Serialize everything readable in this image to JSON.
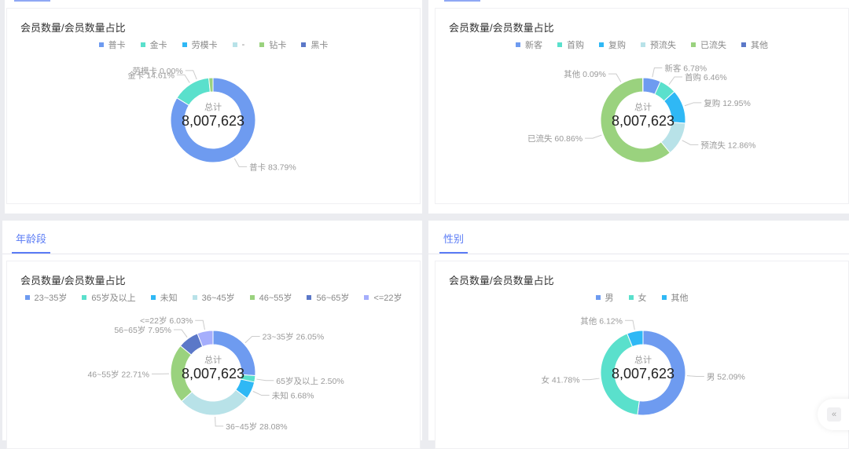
{
  "tabs": {
    "age": "年龄段",
    "gender": "性别"
  },
  "collapse_label": "«",
  "chart_data": [
    {
      "type": "pie",
      "title": "会员数量/会员数量占比",
      "center_label": "总计",
      "total": "8,007,623",
      "categories": [
        "普卡",
        "金卡",
        "劳模卡",
        "-",
        "钻卡",
        "黑卡"
      ],
      "values": [
        83.79,
        14.61,
        0.0,
        0,
        1.6,
        0
      ],
      "labels": [
        "普卡 83.79%",
        "金卡 14.61%",
        "劳模卡 0.00%",
        "",
        "",
        ""
      ],
      "colors": [
        "#6e9bf0",
        "#5ae0cc",
        "#2fb8f5",
        "#b8e2e8",
        "#9ad27e",
        "#5b78c8"
      ]
    },
    {
      "type": "pie",
      "title": "会员数量/会员数量占比",
      "center_label": "总计",
      "total": "8,007,623",
      "categories": [
        "新客",
        "首购",
        "复购",
        "预流失",
        "已流失",
        "其他"
      ],
      "values": [
        6.78,
        6.46,
        12.95,
        12.86,
        60.86,
        0.09
      ],
      "labels": [
        "新客 6.78%",
        "首购 6.46%",
        "复购 12.95%",
        "预流失 12.86%",
        "已流失 60.86%",
        "其他 0.09%"
      ],
      "colors": [
        "#6e9bf0",
        "#5ae0cc",
        "#2fb8f5",
        "#b8e2e8",
        "#9ad27e",
        "#5b78c8"
      ]
    },
    {
      "type": "pie",
      "title": "会员数量/会员数量占比",
      "center_label": "总计",
      "total": "8,007,623",
      "categories": [
        "23~35岁",
        "65岁及以上",
        "未知",
        "36~45岁",
        "46~55岁",
        "56~65岁",
        "<=22岁"
      ],
      "values": [
        26.05,
        2.5,
        6.68,
        28.08,
        22.71,
        7.95,
        6.03
      ],
      "labels": [
        "23~35岁 26.05%",
        "65岁及以上 2.50%",
        "未知 6.68%",
        "36~45岁 28.08%",
        "46~55岁 22.71%",
        "56~65岁 7.95%",
        "<=22岁 6.03%"
      ],
      "colors": [
        "#6e9bf0",
        "#5ae0cc",
        "#2fb8f5",
        "#b8e2e8",
        "#9ad27e",
        "#5b78c8",
        "#a5aefc"
      ]
    },
    {
      "type": "pie",
      "title": "会员数量/会员数量占比",
      "center_label": "总计",
      "total": "8,007,623",
      "categories": [
        "男",
        "女",
        "其他"
      ],
      "values": [
        52.09,
        41.78,
        6.12
      ],
      "labels": [
        "男 52.09%",
        "女 41.78%",
        "其他 6.12%"
      ],
      "colors": [
        "#6e9bf0",
        "#5ae0cc",
        "#2fb8f5"
      ]
    }
  ]
}
